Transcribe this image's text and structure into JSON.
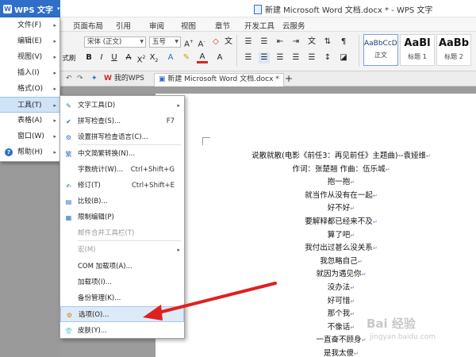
{
  "titlebar": {
    "app_button": "WPS 文字",
    "doc_title": "新建 Microsoft Word 文档.docx * - WPS 文字"
  },
  "menu_tabs": [
    "页面布局",
    "引用",
    "审阅",
    "视图",
    "章节",
    "开发工具",
    "云服务"
  ],
  "ribbon": {
    "format_painter_label": "式刷",
    "font_name": "宋体 (正文)",
    "font_size": "五号",
    "styles": [
      {
        "sample": "AaBbCcDd",
        "name": "正文"
      },
      {
        "sample": "AaBl",
        "name": "标题 1"
      },
      {
        "sample": "AaBb",
        "name": "标题 2"
      }
    ]
  },
  "doc_tabs": {
    "tab1": "我的WPS",
    "tab2": "新建 Microsoft Word 文档.docx *",
    "new_tab": "+"
  },
  "left_menu": [
    {
      "label": "文件(F)",
      "icon": "none"
    },
    {
      "label": "编辑(E)",
      "icon": "none"
    },
    {
      "label": "视图(V)",
      "icon": "none"
    },
    {
      "label": "插入(I)",
      "icon": "none"
    },
    {
      "label": "格式(O)",
      "icon": "none"
    },
    {
      "label": "工具(T)",
      "icon": "none"
    },
    {
      "label": "表格(A)",
      "icon": "none"
    },
    {
      "label": "窗口(W)",
      "icon": "none"
    },
    {
      "label": "帮助(H)",
      "icon": "help-icon"
    }
  ],
  "tools_submenu": [
    {
      "label": "文字工具(D)",
      "shortcut": ""
    },
    {
      "label": "拼写检查(S)...",
      "shortcut": "F7"
    },
    {
      "label": "设置拼写检查语言(C)...",
      "shortcut": ""
    },
    {
      "label": "中文简繁转换(N)...",
      "shortcut": ""
    },
    {
      "label": "字数统计(W)...",
      "shortcut": "Ctrl+Shift+G"
    },
    {
      "label": "修订(T)",
      "shortcut": "Ctrl+Shift+E"
    },
    {
      "label": "比较(B)...",
      "shortcut": ""
    },
    {
      "label": "限制编辑(P)",
      "shortcut": ""
    },
    {
      "label": "邮件合并工具栏(T)",
      "shortcut": ""
    },
    {
      "label": "宏(M)",
      "shortcut": ""
    },
    {
      "label": "COM 加载项(A)...",
      "shortcut": ""
    },
    {
      "label": "加载项(I)...",
      "shortcut": ""
    },
    {
      "label": "备份管理(K)...",
      "shortcut": ""
    },
    {
      "label": "选项(O)...",
      "shortcut": ""
    },
    {
      "label": "皮肤(Y)...",
      "shortcut": ""
    }
  ],
  "document": {
    "poem_lines": [
      "说散就散(电影《前任3：再见前任》主题曲)--袁娅维",
      "作词：张楚翘  作曲：伍乐城",
      "抱一抱",
      "就当作从没有在一起",
      "好不好",
      "要解释都已经来不及",
      "算了吧",
      "我付出过甚么没关系",
      "我忽略自己",
      "就因为遇见你",
      "没办法",
      "好可惜",
      "那个我",
      "不像话",
      "一直奋不顾身",
      "是我太傻"
    ],
    "paragraph_mark": "↵"
  },
  "watermark": {
    "brand": "Bai 经验",
    "url": "jingyan.baidu.com"
  },
  "colors": {
    "accent": "#2f6ec9",
    "arrow": "#e02020"
  }
}
